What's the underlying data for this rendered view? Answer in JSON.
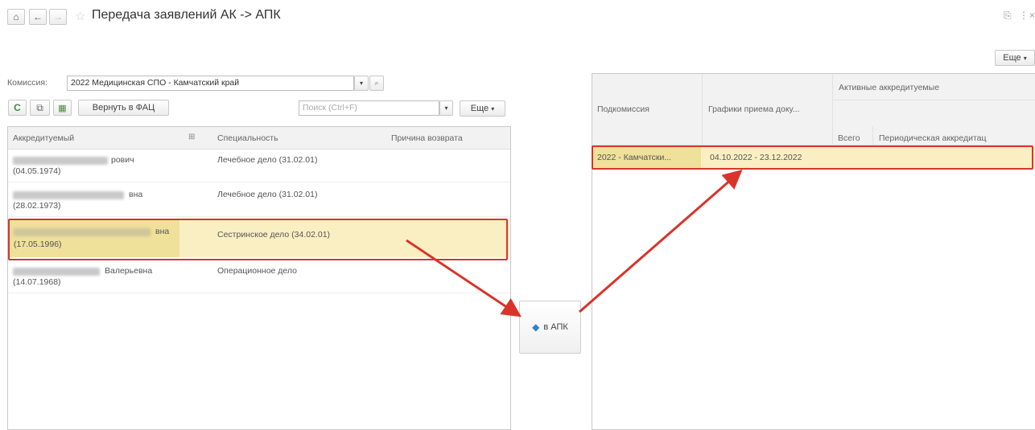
{
  "window": {
    "title": "Передача заявлений АК -> АПК",
    "more_button": "Еще"
  },
  "left": {
    "commission_label": "Комиссия:",
    "commission_value": "2022 Медицинская СПО - Камчатский край",
    "return_button": "Вернуть в ФАЦ",
    "search_placeholder": "Поиск (Ctrl+F)",
    "more_button": "Еще",
    "columns": [
      "Аккредитуемый",
      "Специальность",
      "Причина возврата"
    ],
    "rows": [
      {
        "name": "рович",
        "date": "(04.05.1974)",
        "specialty": "Лечебное дело (31.02.01)"
      },
      {
        "name": "вна",
        "date": "(28.02.1973)",
        "specialty": "Лечебное дело (31.02.01)"
      },
      {
        "name": "вна",
        "date": "(17.05.1996)",
        "specialty": "Сестринское дело (34.02.01)"
      },
      {
        "name": "Валерьевна",
        "date": "(14.07.1968)",
        "specialty": "Операционное дело"
      }
    ]
  },
  "transfer_button": "в АПК",
  "right": {
    "columns": {
      "subcommission": "Подкомиссия",
      "schedule": "Графики приема доку...",
      "active_group": "Активные аккредитуемые",
      "total": "Всего",
      "periodic": "Периодическая аккредитац"
    },
    "rows": [
      {
        "subcommission": "2022 - Камчатски...",
        "schedule": "04.10.2022 - 23.12.2022"
      }
    ]
  },
  "colors": {
    "highlight_bg": "#faefc2",
    "highlight_border": "#d9342b",
    "arrow": "#d9342b"
  }
}
